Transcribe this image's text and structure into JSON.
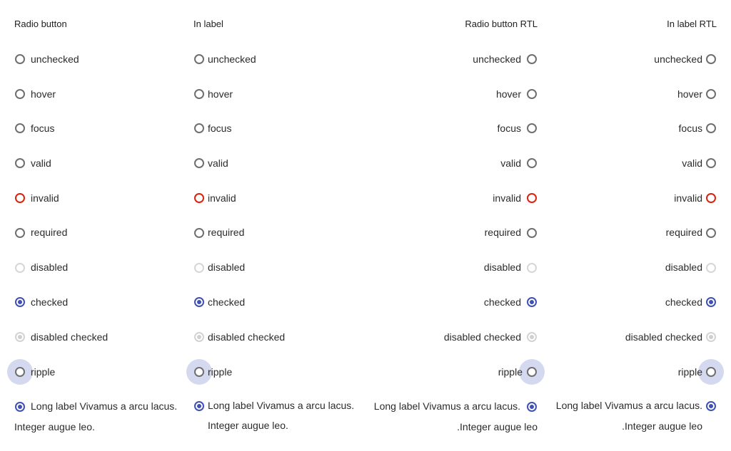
{
  "columns": [
    {
      "title": "Radio button",
      "states": [
        "unchecked",
        "hover",
        "focus",
        "valid",
        "invalid",
        "required",
        "disabled",
        "checked",
        "disabled checked",
        "ripple"
      ],
      "long_label": {
        "line1": "Long label Vivamus a arcu lacus.",
        "line2": "Integer augue leo."
      }
    },
    {
      "title": "In label",
      "states": [
        "unchecked",
        "hover",
        "focus",
        "valid",
        "invalid",
        "required",
        "disabled",
        "checked",
        "disabled checked",
        "ripple"
      ],
      "long_label": {
        "line1": "Long label Vivamus a arcu lacus.",
        "line2": "Integer augue leo."
      }
    },
    {
      "title": "Radio button RTL",
      "states": [
        "unchecked",
        "hover",
        "focus",
        "valid",
        "invalid",
        "required",
        "disabled",
        "checked",
        "disabled checked",
        "ripple"
      ],
      "long_label": {
        "line1": "Long label Vivamus a arcu lacus.",
        "line2": ".Integer augue leo"
      }
    },
    {
      "title": "In label RTL",
      "states": [
        "unchecked",
        "hover",
        "focus",
        "valid",
        "invalid",
        "required",
        "disabled",
        "checked",
        "disabled checked",
        "ripple"
      ],
      "long_label": {
        "line1": "Long label Vivamus a arcu lacus.",
        "line2": ".Integer augue leo"
      }
    }
  ],
  "colors": {
    "accent": "#3f51b5",
    "invalid": "#d9230f",
    "border": "#6f6f6f",
    "disabled": "#d6d6d6"
  }
}
